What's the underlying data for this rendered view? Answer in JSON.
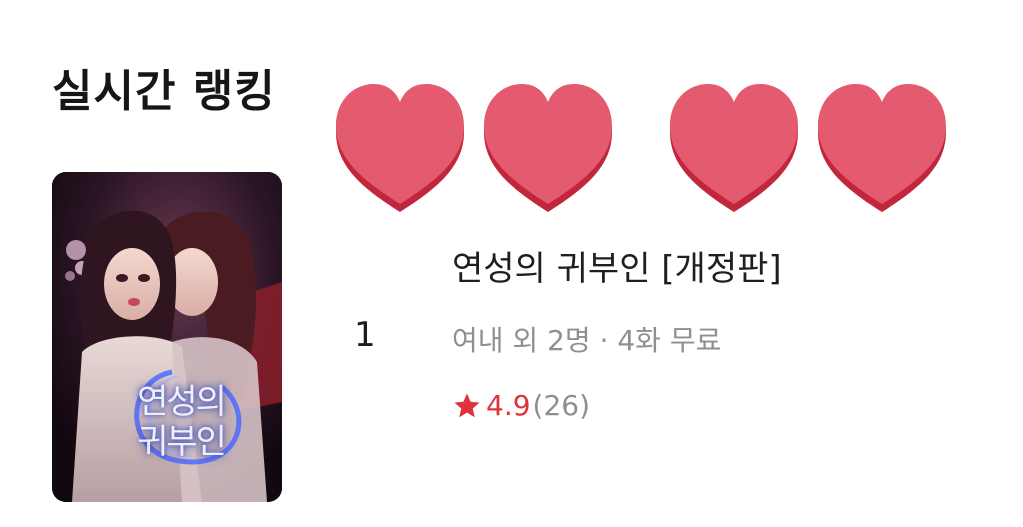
{
  "section": {
    "title": "실시간 랭킹"
  },
  "decorations": {
    "icon": "heart-icon",
    "count": 4,
    "color": "#e45a6e",
    "shadow_color": "#c2263c"
  },
  "item": {
    "rank": "1",
    "title": "연성의 귀부인 [개정판]",
    "meta": "여내 외 2명 · 4화 무료",
    "rating": {
      "icon": "star-icon",
      "value": "4.9",
      "count": "(26)",
      "color": "#e0323a"
    },
    "cover": {
      "title_line1": "연성의",
      "title_line2": "귀부인"
    }
  }
}
